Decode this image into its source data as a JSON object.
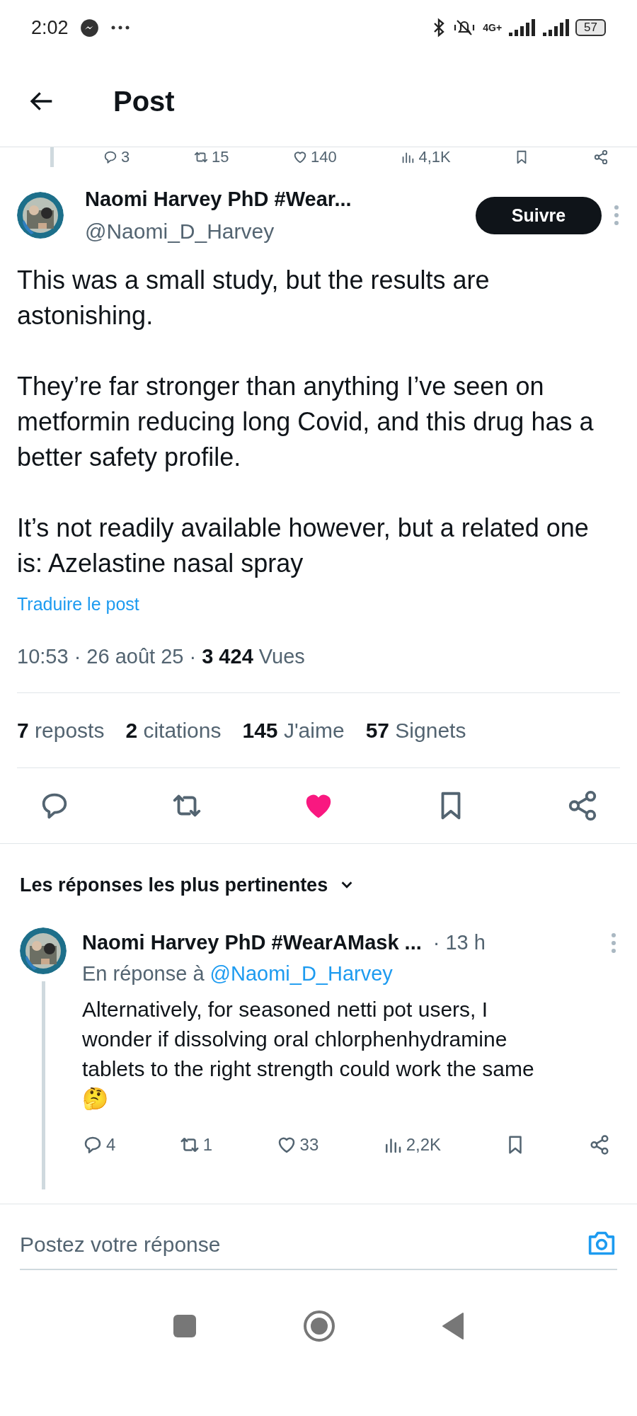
{
  "status_bar": {
    "time": "2:02",
    "network": "4G+",
    "battery": "57"
  },
  "header": {
    "title": "Post"
  },
  "previous_post_actions": [
    {
      "kind": "reply",
      "count": "3"
    },
    {
      "kind": "repost",
      "count": "15"
    },
    {
      "kind": "like",
      "count": "140"
    },
    {
      "kind": "views",
      "count": "4,1K"
    },
    {
      "kind": "bookmark"
    },
    {
      "kind": "share"
    }
  ],
  "post": {
    "author": "Naomi Harvey PhD #Wear...",
    "handle": "@Naomi_D_Harvey",
    "follow_button": "Suivre",
    "paragraphs": [
      "This was a small study, but the results are astonishing.",
      "They’re far stronger than anything I’ve seen on metformin reducing long Covid, and this drug has a better safety profile.",
      "It’s not readily available however, but a related one is: Azelastine nasal spray"
    ],
    "translate": "Traduire le post",
    "meta": "10:53 · 26 août 25 · **3 424** Vues",
    "stats": [
      "**7** reposts",
      "**2** citations",
      "**145** J'aime",
      "**57** Signets"
    ],
    "actions": [
      {
        "kind": "reply"
      },
      {
        "kind": "repost"
      },
      {
        "kind": "like",
        "liked": true
      },
      {
        "kind": "bookmark"
      },
      {
        "kind": "share"
      }
    ]
  },
  "replies_sort": "Les réponses les plus pertinentes",
  "replies": [
    {
      "author": "Naomi Harvey PhD #WearAMask ...",
      "time": "· 13 h",
      "reply_prefix": "En réponse à",
      "reply_to": "@Naomi_D_Harvey",
      "text": "Alternatively, for seasoned netti pot users, I wonder if dissolving oral chlorphenhydramine tablets to the right strength could work the same 🤔",
      "actions": [
        {
          "kind": "reply",
          "count": "4"
        },
        {
          "kind": "repost",
          "count": "1"
        },
        {
          "kind": "like",
          "count": "33"
        },
        {
          "kind": "views",
          "count": "2,2K"
        },
        {
          "kind": "bookmark"
        },
        {
          "kind": "share"
        }
      ]
    }
  ],
  "composer": {
    "placeholder": "Postez votre réponse"
  }
}
